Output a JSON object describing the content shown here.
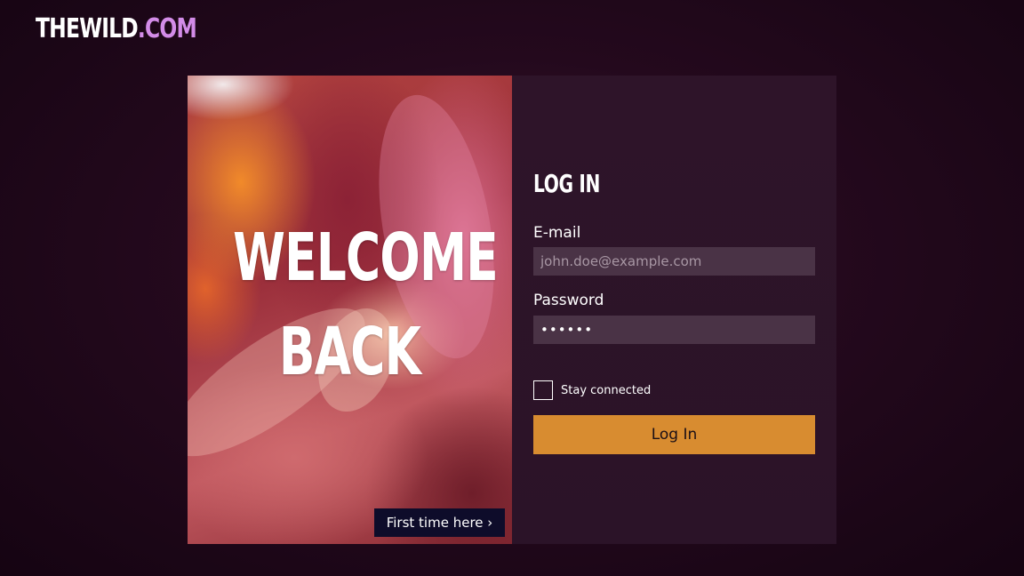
{
  "brand": {
    "name": "THEWILD",
    "domain_suffix": ".COM",
    "accent_color": "#d38ce8"
  },
  "hero": {
    "line1": "WELCOME",
    "line2": "BACK",
    "first_time_link": "First time here ›"
  },
  "login": {
    "title": "LOG IN",
    "email_label": "E-mail",
    "email_placeholder": "john.doe@example.com",
    "password_label": "Password",
    "password_value": "••••••",
    "stay_connected_label": "Stay connected",
    "stay_connected_checked": false,
    "submit_label": "Log In",
    "submit_color": "#d88c30"
  }
}
